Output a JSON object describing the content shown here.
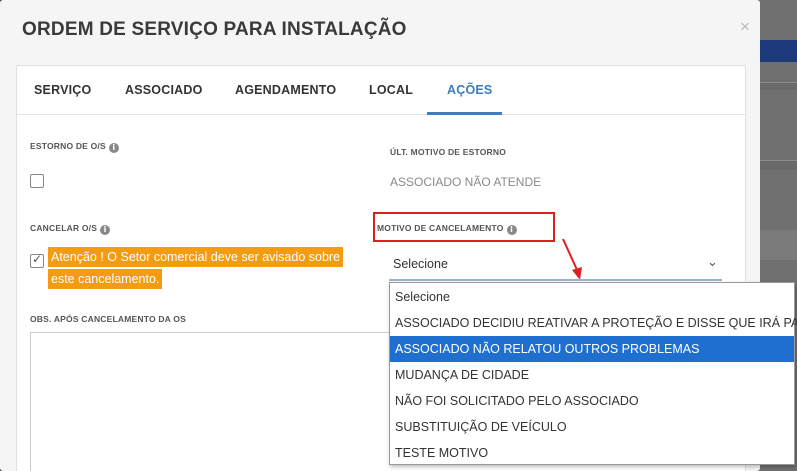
{
  "modal": {
    "title": "ORDEM DE SERVIÇO PARA INSTALAÇÃO",
    "close": "×"
  },
  "tabs": [
    {
      "label": "SERVIÇO"
    },
    {
      "label": "ASSOCIADO"
    },
    {
      "label": "AGENDAMENTO"
    },
    {
      "label": "LOCAL"
    },
    {
      "label": "AÇÕES",
      "active": true
    }
  ],
  "estorno": {
    "label": "ESTORNO DE O/S",
    "checked": false
  },
  "ult_motivo": {
    "label": "ÚLT. MOTIVO DE ESTORNO",
    "value": "ASSOCIADO NÃO ATENDE"
  },
  "cancelar": {
    "label": "CANCELAR O/S",
    "checked": true,
    "warning_line1": "Atenção ! O Setor comercial deve ser avisado sobre",
    "warning_line2": "este cancelamento."
  },
  "motivo": {
    "label": "MOTIVO DE CANCELAMENTO",
    "selected": "Selecione",
    "options": [
      "Selecione",
      "ASSOCIADO DECIDIU REATIVAR A PROTEÇÃO E DISSE QUE IRÁ PAGAR",
      "ASSOCIADO NÃO RELATOU OUTROS PROBLEMAS",
      "MUDANÇA DE CIDADE",
      "NÃO FOI SOLICITADO PELO ASSOCIADO",
      "SUBSTITUIÇÃO DE VEÍCULO",
      "TESTE MOTIVO"
    ],
    "highlighted_index": 2
  },
  "obs": {
    "label": "OBS. APÓS CANCELAMENTO DA OS"
  },
  "icons": {
    "info": "i",
    "chevron": "⌄",
    "check": "✓",
    "arrow": "red-arrow-icon"
  },
  "colors": {
    "accent": "#3d7cc0",
    "warning": "#f39c12",
    "highlight": "#1e6fd0",
    "annotation": "#e02020"
  }
}
